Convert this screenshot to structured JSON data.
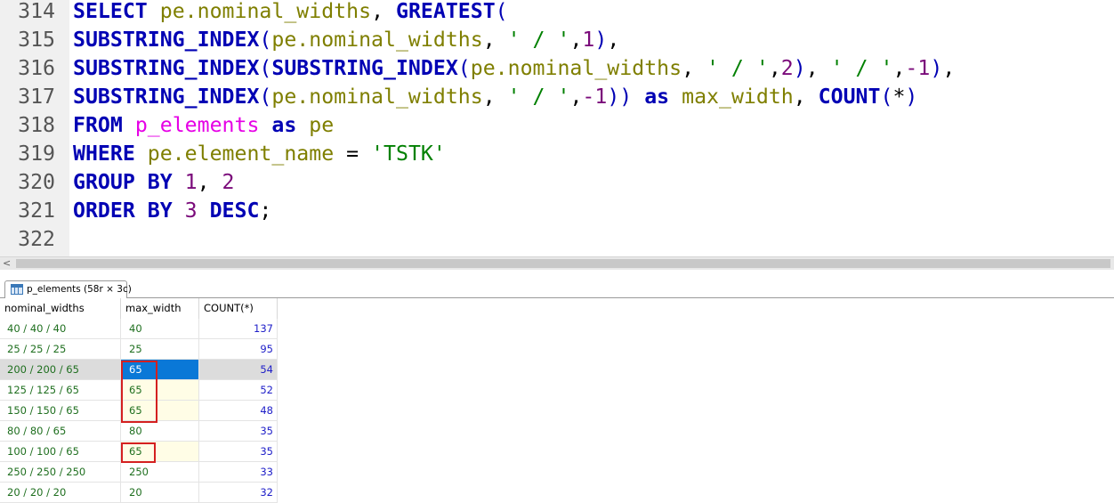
{
  "editor": {
    "lines": [
      {
        "num": "314",
        "tokens": [
          [
            "kw",
            "SELECT "
          ],
          [
            "ident",
            "pe.nominal_widths"
          ],
          [
            "punct",
            ", "
          ],
          [
            "kw",
            "GREATEST"
          ],
          [
            "paren",
            "("
          ]
        ]
      },
      {
        "num": "315",
        "tokens": [
          [
            "kw",
            "SUBSTRING_INDEX"
          ],
          [
            "paren",
            "("
          ],
          [
            "ident",
            "pe.nominal_widths"
          ],
          [
            "punct",
            ", "
          ],
          [
            "str",
            "' / '"
          ],
          [
            "punct",
            ","
          ],
          [
            "num",
            "1"
          ],
          [
            "paren",
            ")"
          ],
          [
            "punct",
            ","
          ]
        ]
      },
      {
        "num": "316",
        "tokens": [
          [
            "kw",
            "SUBSTRING_INDEX"
          ],
          [
            "paren",
            "("
          ],
          [
            "kw",
            "SUBSTRING_INDEX"
          ],
          [
            "paren",
            "("
          ],
          [
            "ident",
            "pe.nominal_widths"
          ],
          [
            "punct",
            ", "
          ],
          [
            "str",
            "' / '"
          ],
          [
            "punct",
            ","
          ],
          [
            "num",
            "2"
          ],
          [
            "paren",
            ")"
          ],
          [
            "punct",
            ", "
          ],
          [
            "str",
            "' / '"
          ],
          [
            "punct",
            ","
          ],
          [
            "num",
            "-1"
          ],
          [
            "paren",
            ")"
          ],
          [
            "punct",
            ","
          ]
        ]
      },
      {
        "num": "317",
        "tokens": [
          [
            "kw",
            "SUBSTRING_INDEX"
          ],
          [
            "paren",
            "("
          ],
          [
            "ident",
            "pe.nominal_widths"
          ],
          [
            "punct",
            ", "
          ],
          [
            "str",
            "' / '"
          ],
          [
            "punct",
            ","
          ],
          [
            "num",
            "-1"
          ],
          [
            "paren",
            "))"
          ],
          [
            "punct",
            " "
          ],
          [
            "kw",
            "as "
          ],
          [
            "ident",
            "max_width"
          ],
          [
            "punct",
            ", "
          ],
          [
            "kw",
            "COUNT"
          ],
          [
            "paren",
            "("
          ],
          [
            "punct",
            "*"
          ],
          [
            "paren",
            ")"
          ]
        ]
      },
      {
        "num": "318",
        "tokens": [
          [
            "kw",
            "FROM "
          ],
          [
            "tbl",
            "p_elements"
          ],
          [
            "punct",
            " "
          ],
          [
            "kw",
            "as "
          ],
          [
            "ident",
            "pe"
          ]
        ]
      },
      {
        "num": "319",
        "tokens": [
          [
            "kw",
            "WHERE "
          ],
          [
            "ident",
            "pe.element_name"
          ],
          [
            "op",
            " = "
          ],
          [
            "str",
            "'TSTK'"
          ]
        ]
      },
      {
        "num": "320",
        "tokens": [
          [
            "kw",
            "GROUP BY "
          ],
          [
            "num",
            "1"
          ],
          [
            "punct",
            ", "
          ],
          [
            "num",
            "2"
          ]
        ]
      },
      {
        "num": "321",
        "tokens": [
          [
            "kw",
            "ORDER BY "
          ],
          [
            "num",
            "3 "
          ],
          [
            "kw",
            "DESC"
          ],
          [
            "punct",
            ";"
          ]
        ]
      },
      {
        "num": "322",
        "tokens": []
      }
    ]
  },
  "scrollbar": {
    "left_arrow": "<"
  },
  "result_tab": {
    "label": "p_elements (58r × 3c)"
  },
  "grid": {
    "columns": [
      "nominal_widths",
      "max_width",
      "COUNT(*)"
    ],
    "rows": [
      [
        "40 / 40 / 40",
        "40",
        "137"
      ],
      [
        "25 / 25 / 25",
        "25",
        "95"
      ],
      [
        "200 / 200 / 65",
        "65",
        "54"
      ],
      [
        "125 / 125 / 65",
        "65",
        "52"
      ],
      [
        "150 / 150 / 65",
        "65",
        "48"
      ],
      [
        "80 / 80 / 65",
        "80",
        "35"
      ],
      [
        "100 / 100 / 65",
        "65",
        "35"
      ],
      [
        "250 / 250 / 250",
        "250",
        "33"
      ],
      [
        "20 / 20 / 20",
        "20",
        "32"
      ]
    ],
    "selected_row": 2,
    "tinted_rows": [
      3,
      4,
      6
    ]
  }
}
